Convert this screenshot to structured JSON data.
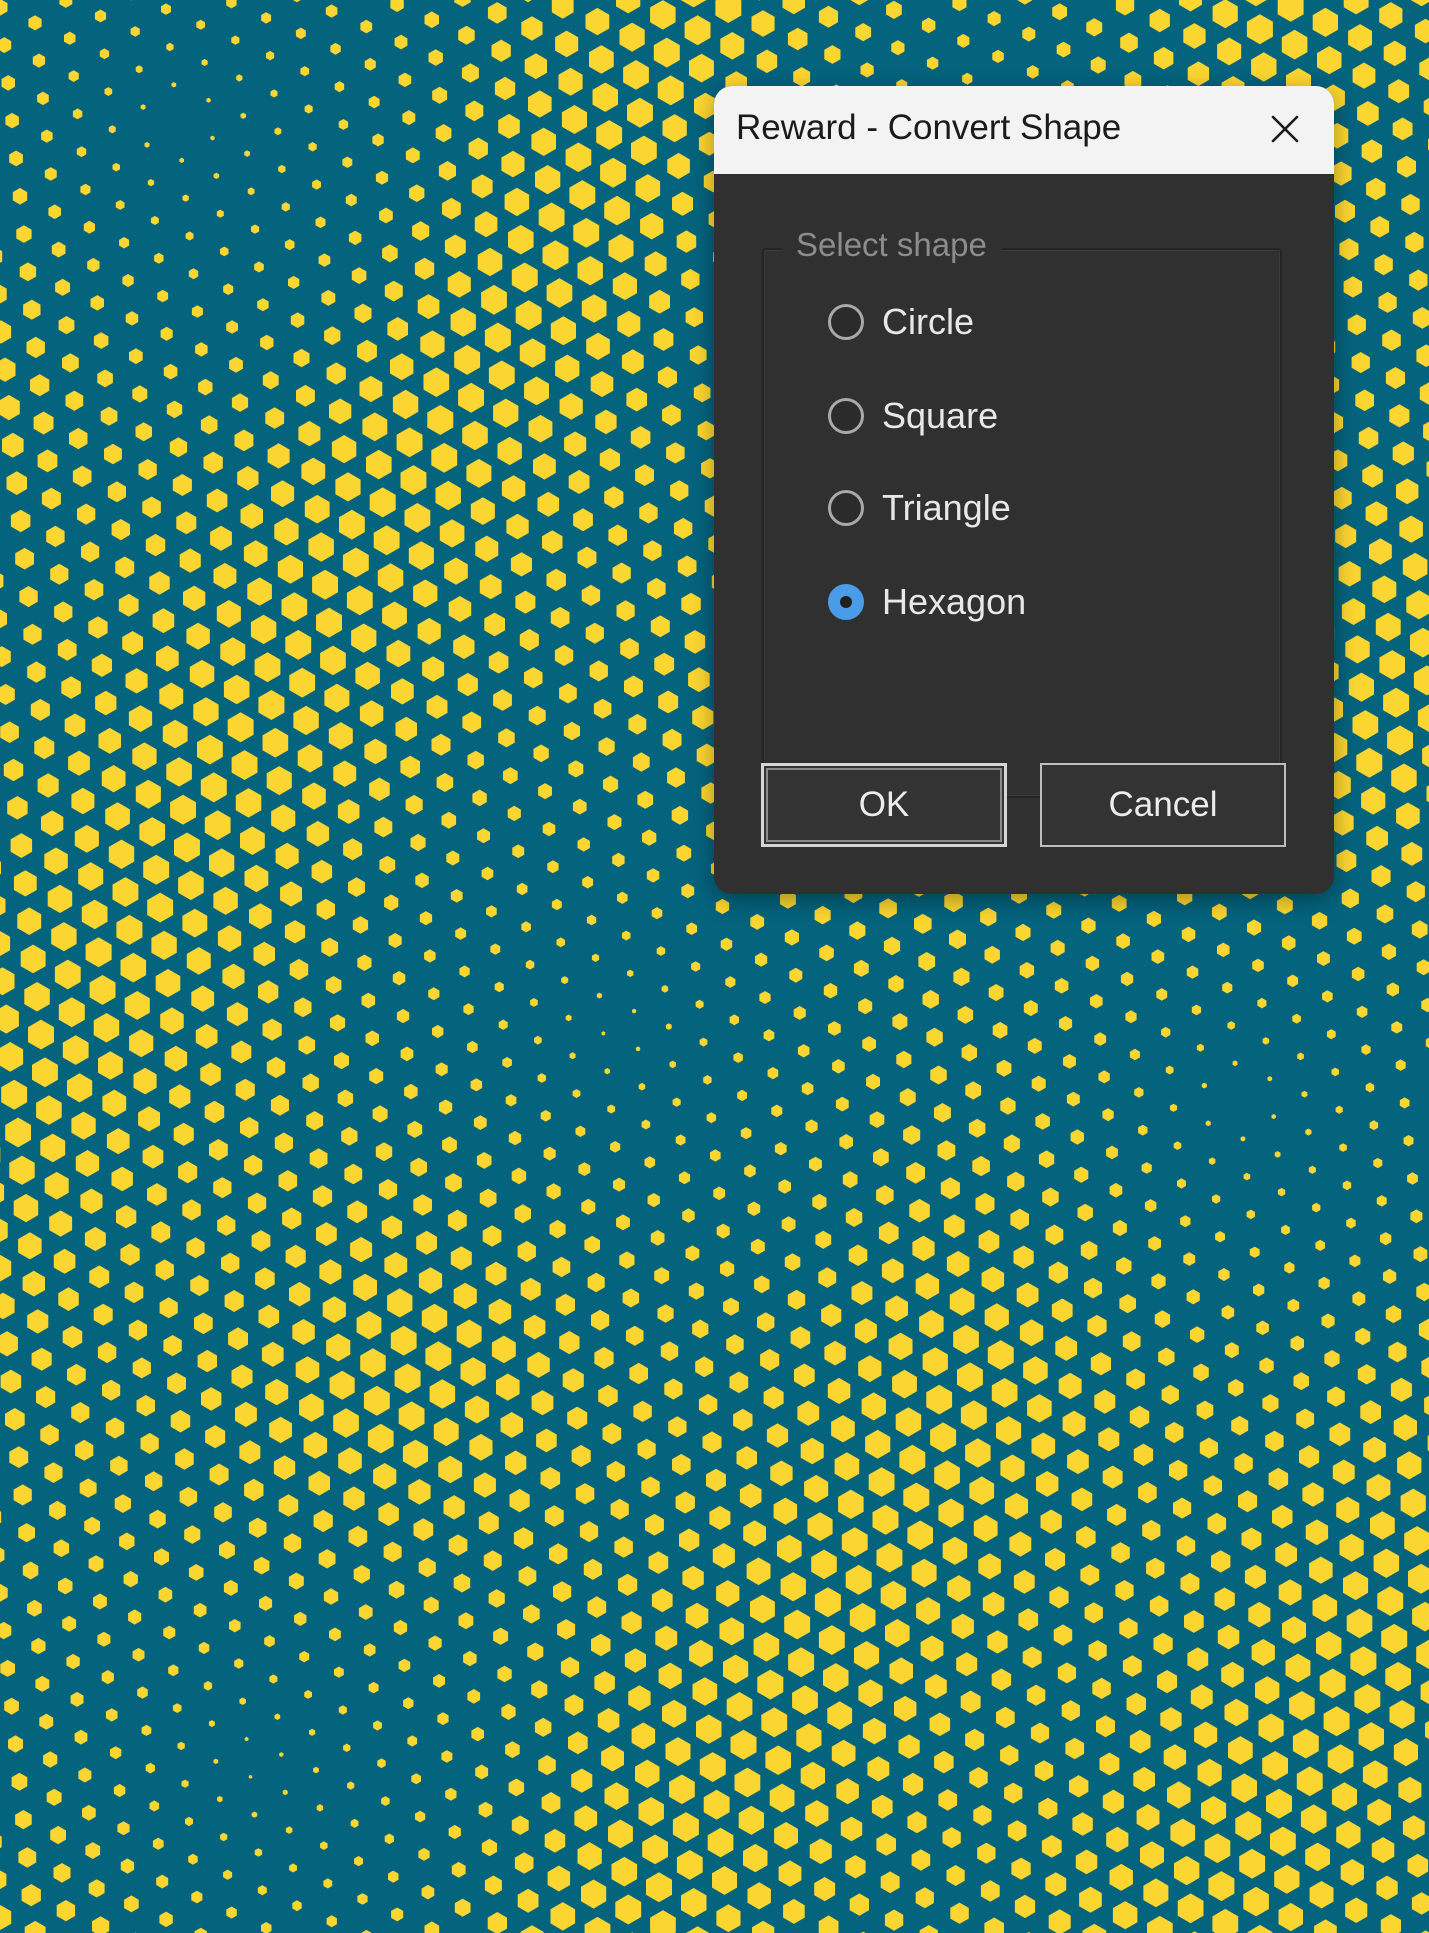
{
  "background": {
    "base_color": "#04637d",
    "dot_color": "#fcd630",
    "dot_shape": "hexagon"
  },
  "dialog": {
    "title": "Reward - Convert Shape",
    "close_icon": "close-icon",
    "group_label": "Select shape",
    "options": [
      {
        "label": "Circle",
        "checked": false
      },
      {
        "label": "Square",
        "checked": false
      },
      {
        "label": "Triangle",
        "checked": false
      },
      {
        "label": "Hexagon",
        "checked": true
      }
    ],
    "selected_shape": "Hexagon",
    "ok_label": "OK",
    "cancel_label": "Cancel",
    "accent_color": "#4a9ce8"
  }
}
